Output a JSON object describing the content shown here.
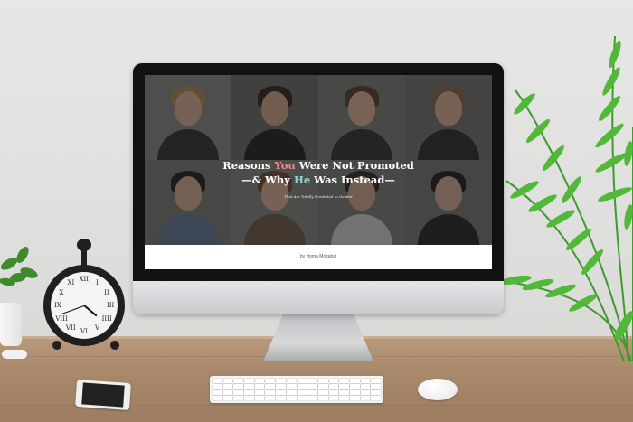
{
  "screen": {
    "headline_part1": "Reasons ",
    "headline_you": "You",
    "headline_part2": " Were Not Promoted",
    "headline_line2_prefix": "—& Why ",
    "headline_he": "He",
    "headline_line2_suffix": " Was Instead—",
    "subtitle": "That Are Totally Unrelated to Gender",
    "byline": "by Homa Mojtabai"
  },
  "clock": {
    "numerals": [
      "XII",
      "I",
      "II",
      "III",
      "IIII",
      "V",
      "VI",
      "VII",
      "VIII",
      "IX",
      "X",
      "XI"
    ]
  },
  "colors": {
    "accent_you": "#f08a8a",
    "accent_he": "#8fd3cf",
    "screen_overlay": "#1e1e1e",
    "footer_bg": "#ffffff"
  }
}
